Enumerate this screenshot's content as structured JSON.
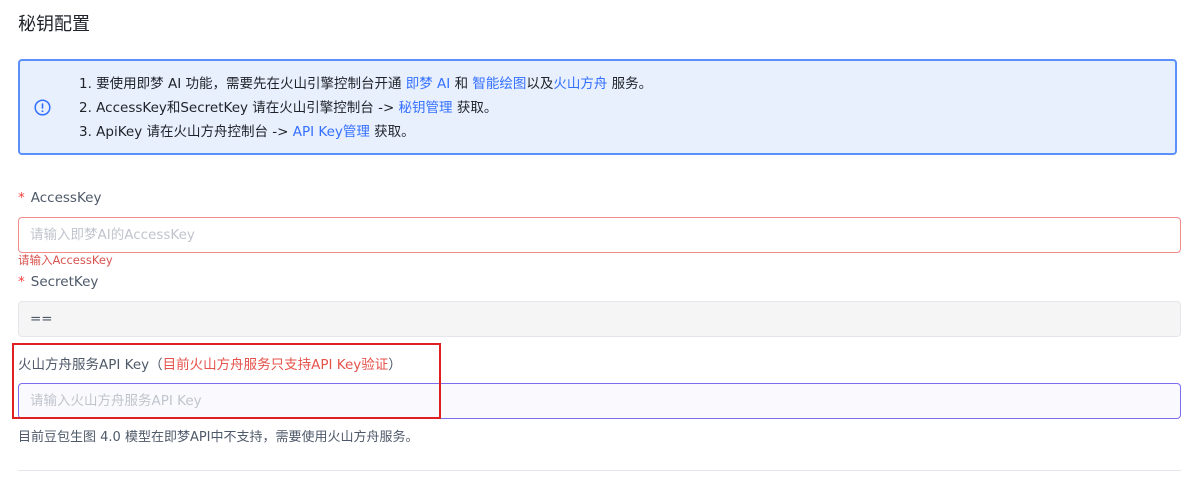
{
  "page": {
    "title": "秘钥配置"
  },
  "alert": {
    "icon": "info-circle-icon",
    "line1": {
      "prefix": "1. 要使用即梦 AI 功能，需要先在火山引擎控制台开通 ",
      "link1": "即梦 AI",
      "mid1": " 和 ",
      "link2": "智能绘图",
      "mid2": "以及",
      "link3": "火山方舟",
      "suffix": " 服务。"
    },
    "line2": {
      "prefix": "2. AccessKey和SecretKey 请在火山引擎控制台 -> ",
      "link": "秘钥管理",
      "suffix": " 获取。"
    },
    "line3": {
      "prefix": "3. ApiKey 请在火山方舟控制台 -> ",
      "link": "API Key管理",
      "suffix": " 获取。"
    }
  },
  "form": {
    "required_mark": "*",
    "access_key": {
      "label": "AccessKey",
      "placeholder": "请输入即梦AI的AccessKey",
      "value": "",
      "error": "请输入AccessKey"
    },
    "secret_key": {
      "label": "SecretKey",
      "value": "=="
    },
    "api_key": {
      "label": "火山方舟服务API Key",
      "note_open": "（",
      "note": "目前火山方舟服务只支持API Key验证",
      "note_close": "）",
      "placeholder": "请输入火山方舟服务API Key",
      "value": "",
      "help": "目前豆包生图 4.0 模型在即梦API中不支持，需要使用火山方舟服务。"
    }
  },
  "colors": {
    "link": "#3370ff",
    "error": "#f53f3f",
    "alert_border": "#5b8ff9",
    "alert_bg": "#e8effd",
    "highlight": "#e02020"
  }
}
